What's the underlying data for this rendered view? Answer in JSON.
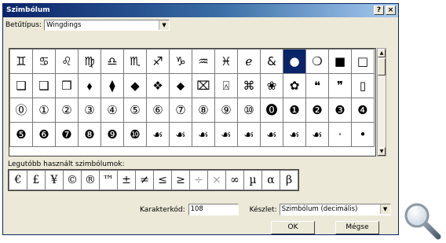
{
  "window": {
    "title": "Szimbólum",
    "help_label": "?",
    "close_label": "×"
  },
  "font": {
    "label": "Betűtípus:",
    "value": "Wingdings"
  },
  "symbols": [
    [
      "♊",
      "♋",
      "♌",
      "♍",
      "♎",
      "♏",
      "♐",
      "♑",
      "♒",
      "♓",
      "ℯ",
      "&",
      "●",
      "❍",
      "■",
      "□"
    ],
    [
      "❏",
      "❑",
      "❒",
      "⬧",
      "⧫",
      "◆",
      "❖",
      "⬥",
      "⌧",
      "⍓",
      "⌘",
      "❀",
      "✿",
      "❝",
      "❞",
      "▯"
    ],
    [
      "⓪",
      "①",
      "②",
      "③",
      "④",
      "⑤",
      "⑥",
      "⑦",
      "⑧",
      "⑨",
      "⑩",
      "⓿",
      "❶",
      "❷",
      "❸",
      "❹"
    ],
    [
      "❺",
      "❻",
      "❼",
      "❽",
      "❾",
      "❿",
      "☙",
      "☙",
      "☙",
      "☙",
      "☙",
      "☙",
      "☙",
      "☙",
      "·",
      "•"
    ]
  ],
  "selected_symbol_index": 12,
  "recent": {
    "label": "Legutóbb használt szimbólumok:",
    "items": [
      "€",
      "£",
      "¥",
      "©",
      "®",
      "™",
      "±",
      "≠",
      "≤",
      "≥",
      "÷",
      "×",
      "∞",
      "µ",
      "α",
      "β"
    ],
    "dimmed_indices": [
      10,
      11
    ]
  },
  "char_code": {
    "label": "Karakterkód:",
    "value": "108"
  },
  "charset": {
    "label": "Készlet:",
    "value": "Szimbólum (decimális)"
  },
  "buttons": {
    "ok": "OK",
    "cancel": "Mégse"
  },
  "colors": {
    "titlebar": "#0a246a",
    "selection": "#0a246a",
    "face": "#ece9d8"
  },
  "icons": {
    "zoom": "magnifier-icon"
  }
}
